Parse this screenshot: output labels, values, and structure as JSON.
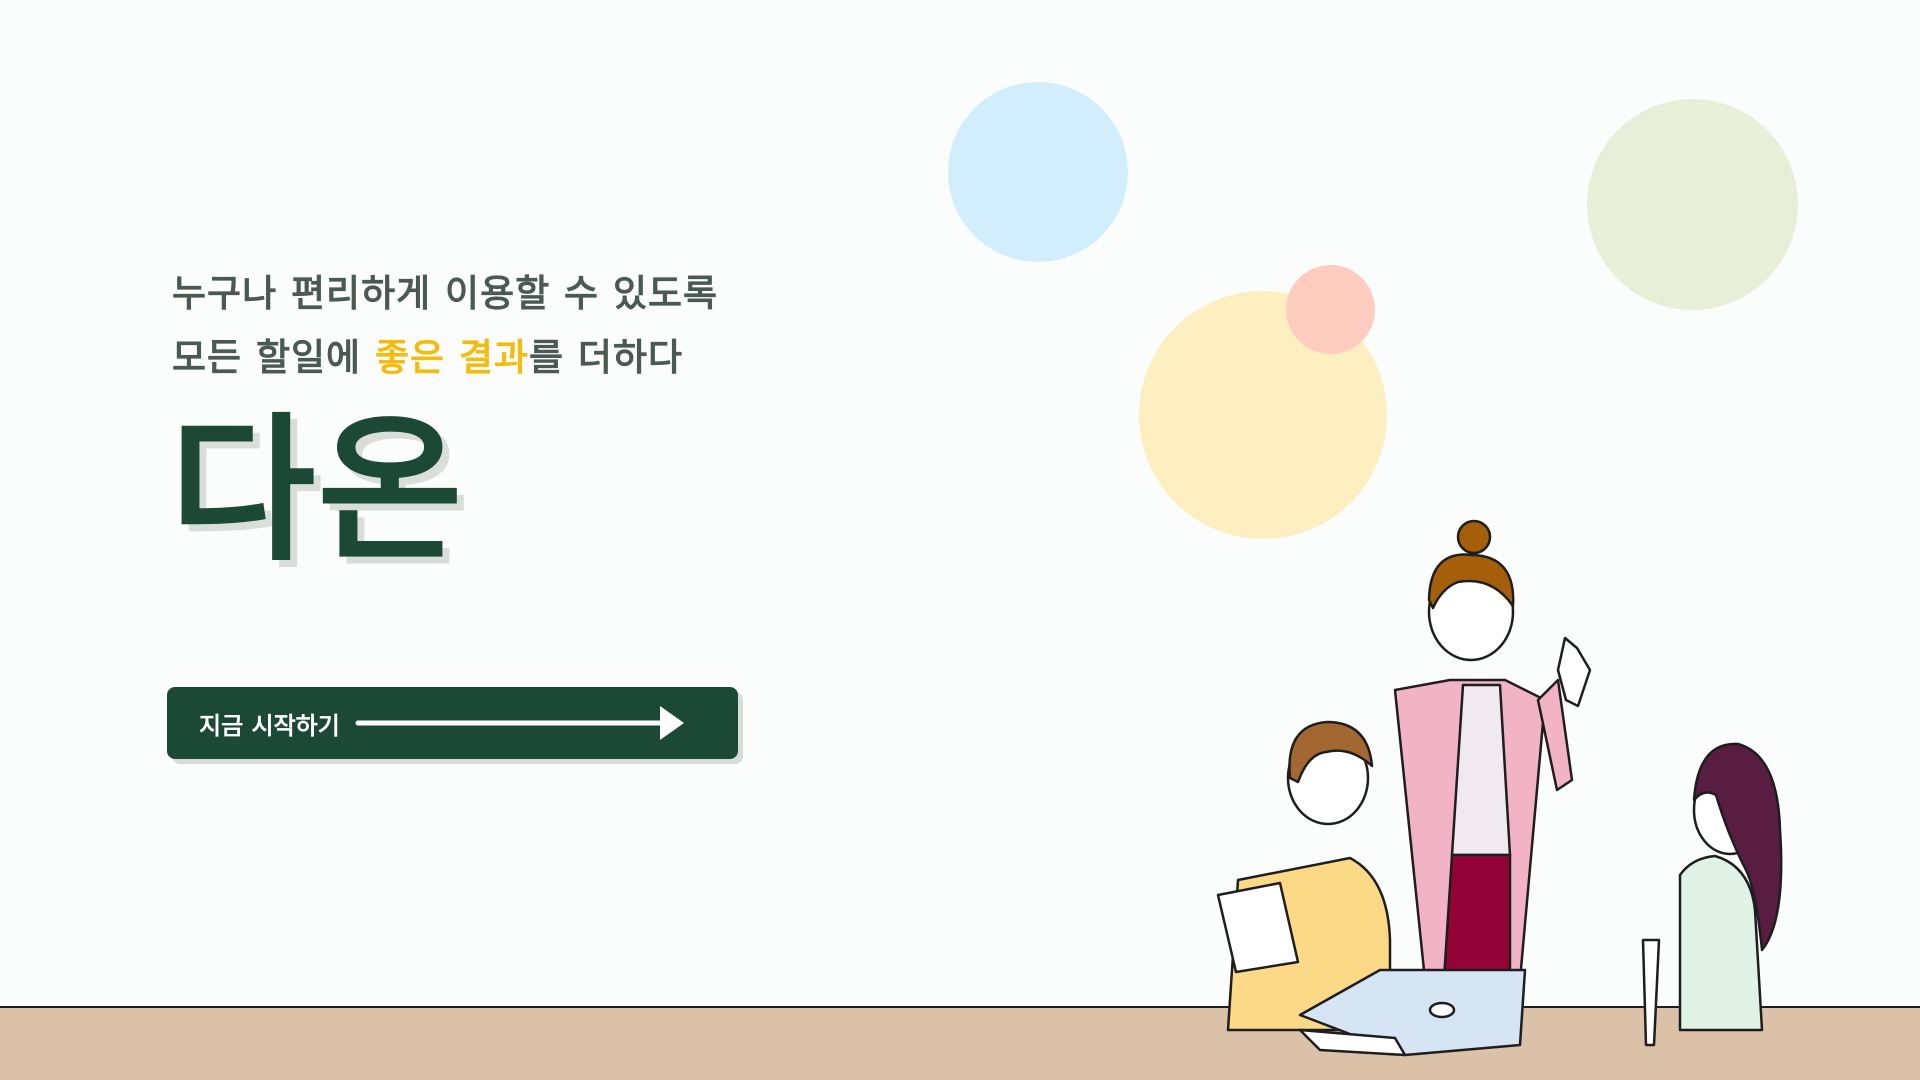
{
  "hero": {
    "tagline_line1": "누구나 편리하게 이용할 수 있도록",
    "tagline_line2_before": "모든 할일에 ",
    "tagline_line2_highlight": "좋은 결과",
    "tagline_line2_after": "를 더하다",
    "brand": "다온",
    "cta_label": "지금 시작하기"
  },
  "icons": {
    "cta_arrow": "arrow-right-icon"
  },
  "colors": {
    "background": "#fbfdfc",
    "primary": "#1c4836",
    "highlight": "#f4bc11",
    "tagline": "#4a5a53",
    "desk": "#dcc1a9"
  }
}
